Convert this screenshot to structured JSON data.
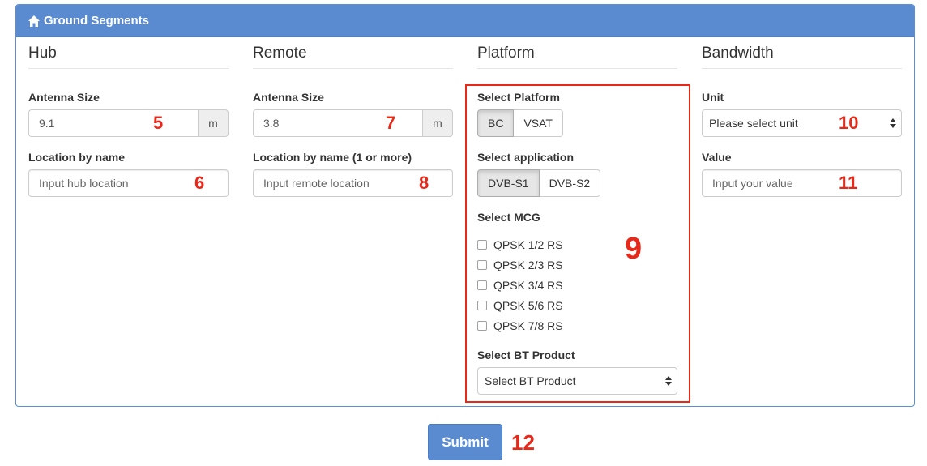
{
  "panel": {
    "title": "Ground Segments",
    "icon": "home-icon"
  },
  "hub": {
    "heading": "Hub",
    "antenna_label": "Antenna Size",
    "antenna_value": "9.1",
    "antenna_unit": "m",
    "location_label": "Location by name",
    "location_placeholder": "Input hub location"
  },
  "remote": {
    "heading": "Remote",
    "antenna_label": "Antenna Size",
    "antenna_value": "3.8",
    "antenna_unit": "m",
    "location_label": "Location by name (1 or more)",
    "location_placeholder": "Input remote location"
  },
  "platform": {
    "heading": "Platform",
    "select_platform_label": "Select Platform",
    "platforms": [
      "BC",
      "VSAT"
    ],
    "platform_selected": "BC",
    "select_application_label": "Select application",
    "applications": [
      "DVB-S1",
      "DVB-S2"
    ],
    "application_selected": "DVB-S1",
    "select_mcg_label": "Select MCG",
    "mcg_options": [
      "QPSK 1/2 RS",
      "QPSK 2/3 RS",
      "QPSK 3/4 RS",
      "QPSK 5/6 RS",
      "QPSK 7/8 RS"
    ],
    "bt_product_label": "Select BT Product",
    "bt_product_value": "Select BT Product"
  },
  "bandwidth": {
    "heading": "Bandwidth",
    "unit_label": "Unit",
    "unit_value": "Please select unit",
    "value_label": "Value",
    "value_placeholder": "Input your value"
  },
  "annotations": [
    "5",
    "6",
    "7",
    "8",
    "9",
    "10",
    "11",
    "12"
  ],
  "submit_label": "Submit",
  "colors": {
    "primary": "#5a8bd1",
    "annotation": "#e8291a"
  }
}
